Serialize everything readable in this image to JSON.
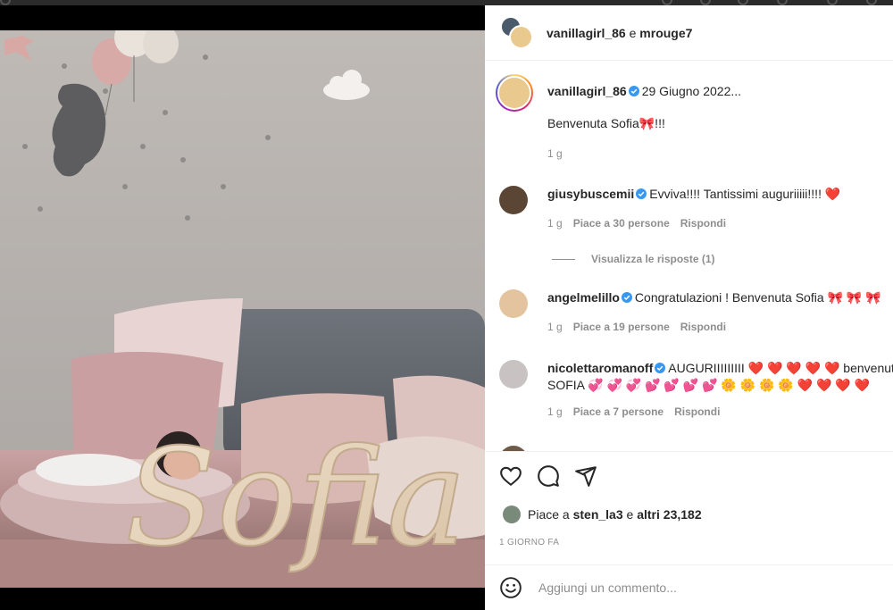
{
  "header": {
    "user1": "vanillagirl_86",
    "conjunction": "e",
    "user2": "mrouge7"
  },
  "post": {
    "author": "vanillagirl_86",
    "date": "29 Giugno 2022...",
    "caption": "Benvenuta Sofia🎀!!!",
    "age": "1 g",
    "photo_text": "Sofia"
  },
  "comments": [
    {
      "user": "giusybuscemii",
      "verified": true,
      "text": "Evviva!!!! Tantissimi auguriiiii!!!! ❤️",
      "age": "1 g",
      "likes": "Piace a 30 persone",
      "reply": "Rispondi"
    },
    {
      "user": "angelmelillo",
      "verified": true,
      "text": "Congratulazioni ! Benvenuta Sofia 🎀 🎀 🎀",
      "age": "1 g",
      "likes": "Piace a 19 persone",
      "reply": "Rispondi"
    },
    {
      "user": "nicolettaromanoff",
      "verified": true,
      "text": "AUGURIIIIIIIII ❤️ ❤️ ❤️ ❤️ ❤️ benvenuta",
      "text2": "SOFIA 💞 💞 💞 💕 💕 💕 💕 🌼 🌼 🌼 🌼 ❤️ ❤️ ❤️ ❤️",
      "age": "1 g",
      "likes": "Piace a 7 persone",
      "reply": "Rispondi"
    }
  ],
  "view_replies": "Visualizza le risposte (1)",
  "likes_summary": {
    "prefix": "Piace a",
    "user": "sten_la3",
    "middle": "e",
    "others": "altri 23,182"
  },
  "time_ago": "1 GIORNO FA",
  "add_comment": {
    "placeholder": "Aggiungi un commento..."
  },
  "icons": [
    "heart-icon",
    "comment-icon",
    "share-icon",
    "emoji-icon",
    "verified-badge-icon"
  ],
  "colors": {
    "verified": "#3897f0",
    "secondary_text": "#8e8e8e",
    "heart": "#ed4956"
  }
}
